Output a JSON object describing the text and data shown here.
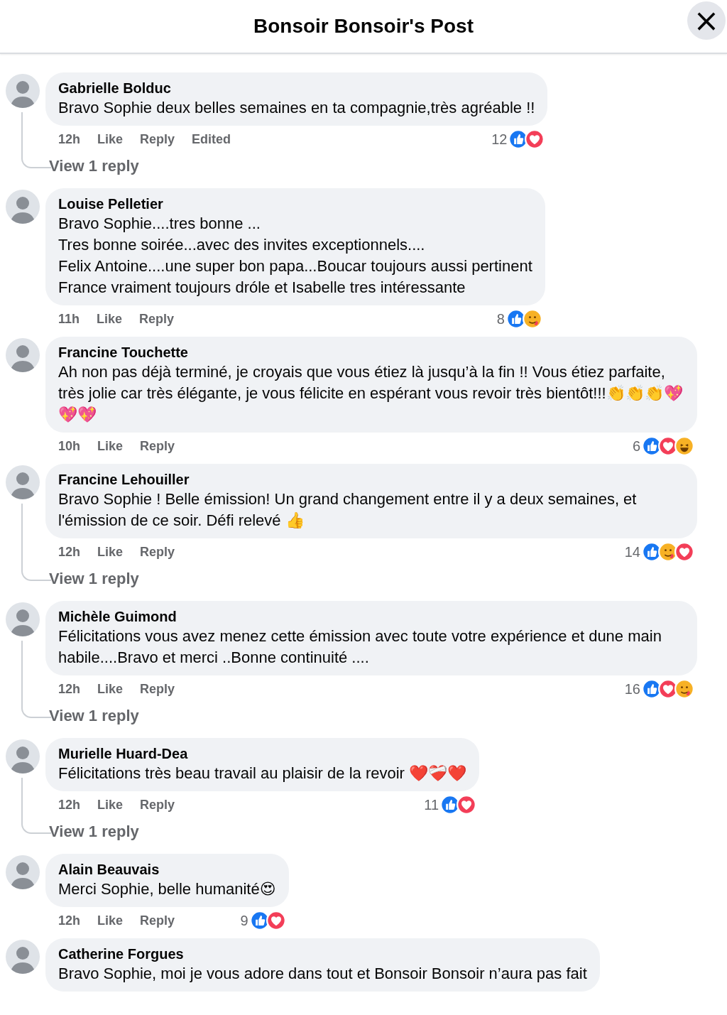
{
  "header": {
    "title": "Bonsoir Bonsoir's Post",
    "close": "×"
  },
  "comments": [
    {
      "author": "Gabrielle Bolduc",
      "text": [
        "Bravo Sophie deux belles semaines en ta compagnie,très agréable !!"
      ],
      "time": "12h",
      "actions": [
        "Like",
        "Reply",
        "Edited"
      ],
      "count": "12",
      "reactions": [
        {
          "kind": "like"
        },
        {
          "kind": "love"
        }
      ],
      "replies_link": "View 1 reply"
    },
    {
      "author": "Louise Pelletier",
      "text": [
        "Bravo Sophie....tres bonne ...",
        "Tres bonne soirée...avec des invites exceptionnels....",
        "Felix Antoine....une super bon papa...Boucar toujours aussi pertinent",
        "France vraiment toujours dróle et Isabelle tres intéressante"
      ],
      "time": "11h",
      "actions": [
        "Like",
        "Reply"
      ],
      "count": "8",
      "reactions": [
        {
          "kind": "like"
        },
        {
          "kind": "care"
        }
      ]
    },
    {
      "author": "Francine Touchette",
      "text": [
        "Ah non pas déjà terminé, je croyais que vous étiez là jusqu’à la fin !! Vous étiez parfaite, très jolie car très élégante, je vous félicite en espérant vous revoir très bientôt!!!👏👏👏💖💖💖"
      ],
      "time": "10h",
      "actions": [
        "Like",
        "Reply"
      ],
      "count": "6",
      "reactions": [
        {
          "kind": "like"
        },
        {
          "kind": "love"
        },
        {
          "kind": "haha"
        }
      ]
    },
    {
      "author": "Francine Lehouiller",
      "text": [
        "Bravo Sophie ! Belle émission! Un grand changement entre il y a deux semaines, et l'émission de ce soir. Défi relevé 👍"
      ],
      "time": "12h",
      "actions": [
        "Like",
        "Reply"
      ],
      "count": "14",
      "reactions": [
        {
          "kind": "like"
        },
        {
          "kind": "care"
        },
        {
          "kind": "love"
        }
      ],
      "replies_link": "View 1 reply"
    },
    {
      "author": "Michèle Guimond",
      "text": [
        "Félicitations vous avez menez cette émission avec toute votre expérience et dune main habile....Bravo et merci ..Bonne continuité ...."
      ],
      "time": "12h",
      "actions": [
        "Like",
        "Reply"
      ],
      "count": "16",
      "reactions": [
        {
          "kind": "like"
        },
        {
          "kind": "love"
        },
        {
          "kind": "care"
        }
      ],
      "replies_link": "View 1 reply"
    },
    {
      "author": "Murielle Huard-Dea",
      "text": [
        "Félicitations très beau travail au plaisir de la revoir ❤️❤️‍🩹❤️"
      ],
      "time": "12h",
      "actions": [
        "Like",
        "Reply"
      ],
      "count": "11",
      "reactions": [
        {
          "kind": "like"
        },
        {
          "kind": "love"
        }
      ],
      "replies_link": "View 1 reply"
    },
    {
      "author": "Alain Beauvais",
      "text": [
        "Merci Sophie, belle humanité😍"
      ],
      "time": "12h",
      "actions": [
        "Like",
        "Reply"
      ],
      "count": "9",
      "reactions": [
        {
          "kind": "like"
        },
        {
          "kind": "love"
        }
      ]
    },
    {
      "author": "Catherine Forgues",
      "text": [
        "Bravo Sophie, moi je vous adore dans tout et Bonsoir Bonsoir n’aura pas fait"
      ]
    }
  ]
}
